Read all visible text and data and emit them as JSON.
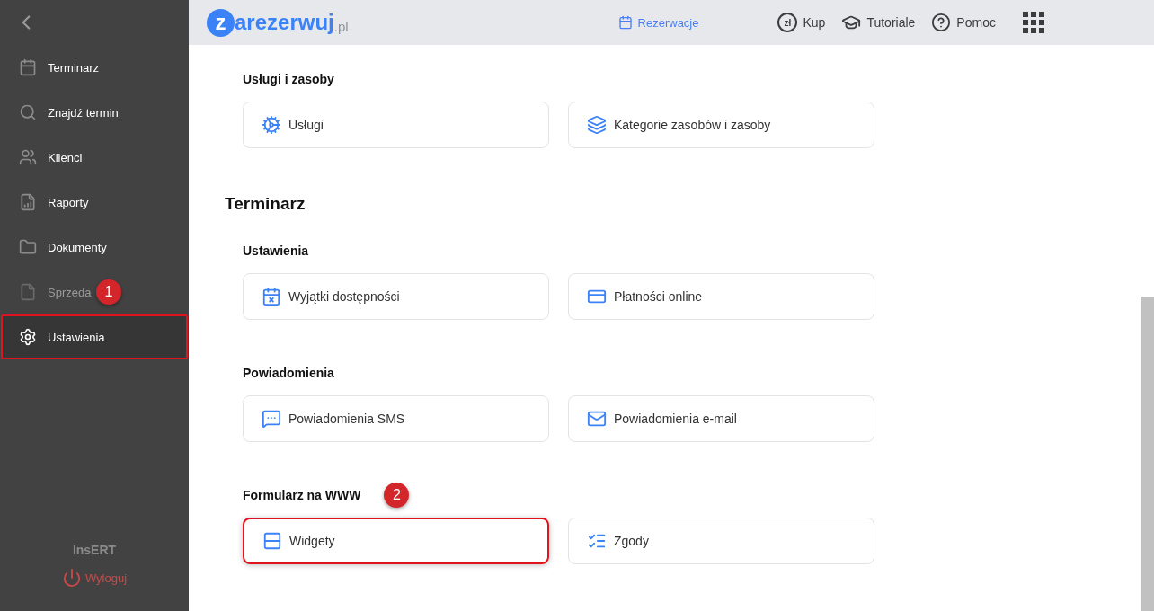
{
  "sidebar": {
    "items": [
      {
        "label": "Terminarz",
        "selected": false,
        "disabled": false
      },
      {
        "label": "Znajdź termin",
        "selected": false,
        "disabled": false
      },
      {
        "label": "Klienci",
        "selected": false,
        "disabled": false
      },
      {
        "label": "Raporty",
        "selected": false,
        "disabled": false
      },
      {
        "label": "Dokumenty",
        "selected": false,
        "disabled": false
      },
      {
        "label": "Sprzeda",
        "selected": false,
        "disabled": true,
        "step": "1"
      },
      {
        "label": "Ustawienia",
        "selected": true,
        "disabled": false,
        "highlighted": true
      }
    ],
    "company": "InsERT",
    "logout": "Wyloguj"
  },
  "header": {
    "logo": {
      "badge": "z",
      "name": "arezerwuj",
      "suffix": ".pl"
    },
    "nav": [
      {
        "label": "Rezerwacje",
        "selected": true
      },
      {
        "label": "Kup",
        "symbol": "zł",
        "selected": false
      },
      {
        "label": "Tutoriale",
        "selected": false
      },
      {
        "label": "Pomoc",
        "selected": false
      }
    ]
  },
  "content": [
    {
      "kind": "group",
      "title": "Usługi i zasoby",
      "cards": [
        {
          "label": "Usługi",
          "highlighted": false
        },
        {
          "label": "Kategorie zasobów i zasoby",
          "highlighted": false
        }
      ]
    },
    {
      "kind": "heading",
      "title": "Terminarz"
    },
    {
      "kind": "group",
      "title": "Ustawienia",
      "cards": [
        {
          "label": "Wyjątki dostępności",
          "highlighted": false
        },
        {
          "label": "Płatności online",
          "highlighted": false
        }
      ]
    },
    {
      "kind": "group",
      "title": "Powiadomienia",
      "cards": [
        {
          "label": "Powiadomienia SMS",
          "highlighted": false
        },
        {
          "label": "Powiadomienia e-mail",
          "highlighted": false
        }
      ]
    },
    {
      "kind": "group",
      "title": "Formularz na WWW",
      "step": "2",
      "cards": [
        {
          "label": "Widgety",
          "highlighted": true
        },
        {
          "label": "Zgody",
          "highlighted": false
        }
      ]
    }
  ]
}
